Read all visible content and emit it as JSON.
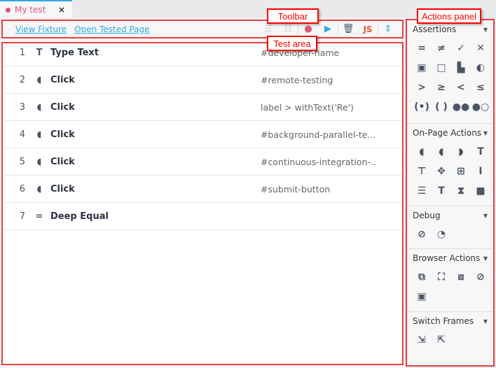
{
  "tab": {
    "title": "My test",
    "close": "×"
  },
  "toolbar": {
    "links": [
      "View Fixture",
      "Open Tested Page"
    ],
    "icons": [
      {
        "name": "list-icon",
        "glyph": "☰",
        "color": "#c5cbd3"
      },
      {
        "name": "list-numbered-icon",
        "glyph": "☷",
        "color": "#c5cbd3"
      },
      {
        "name": "record-icon",
        "glyph": "●",
        "color": "#e25377"
      },
      {
        "name": "play-icon",
        "glyph": "▶",
        "color": "#2fa8e0"
      },
      {
        "name": "trash-icon",
        "glyph": "🗑",
        "color": "#4a5566"
      },
      {
        "name": "js-icon",
        "glyph": "JS",
        "color": "#f0582a"
      },
      {
        "name": "collapse-icon",
        "glyph": "⇕",
        "color": "#2fa8e0"
      }
    ]
  },
  "steps": [
    {
      "num": "1",
      "icon": "T",
      "icon_name": "type-text-icon",
      "name": "Type Text",
      "selector": "#developer-name"
    },
    {
      "num": "2",
      "icon": "◖",
      "icon_name": "mouse-icon",
      "name": "Click",
      "selector": "#remote-testing"
    },
    {
      "num": "3",
      "icon": "◖",
      "icon_name": "mouse-icon",
      "name": "Click",
      "selector": "label > withText('Re')"
    },
    {
      "num": "4",
      "icon": "◖",
      "icon_name": "mouse-icon",
      "name": "Click",
      "selector": "#background-parallel-te..."
    },
    {
      "num": "5",
      "icon": "◖",
      "icon_name": "mouse-icon",
      "name": "Click",
      "selector": "#continuous-integration-.."
    },
    {
      "num": "6",
      "icon": "◖",
      "icon_name": "mouse-icon",
      "name": "Click",
      "selector": "#submit-button"
    },
    {
      "num": "7",
      "icon": "=",
      "icon_name": "equal-icon",
      "name": "Deep Equal",
      "selector": ""
    }
  ],
  "panel": {
    "sections": [
      {
        "title": "Assertions",
        "icons": [
          "=",
          "≠",
          "✓",
          "✕",
          "▣",
          "□",
          "▙",
          "◐",
          ">",
          "≥",
          "<",
          "≤",
          "(•)",
          "( )",
          "●●",
          "●○"
        ]
      },
      {
        "title": "On-Page Actions",
        "icons": [
          "◖",
          "◖",
          "◗",
          "T",
          "⊤",
          "✥",
          "⊞",
          "I",
          "☰",
          "T",
          "⧗",
          "■"
        ]
      },
      {
        "title": "Debug",
        "icons": [
          "⊘",
          "◔"
        ]
      },
      {
        "title": "Browser Actions",
        "icons": [
          "⧉",
          "⛶",
          "⧈",
          "⊘",
          "▣"
        ]
      },
      {
        "title": "Switch Frames",
        "icons": [
          "⇲",
          "⇱"
        ]
      }
    ]
  },
  "annotations": {
    "toolbar": "Toolbar",
    "test_area": "Test area",
    "actions_panel": "Actions panel"
  }
}
